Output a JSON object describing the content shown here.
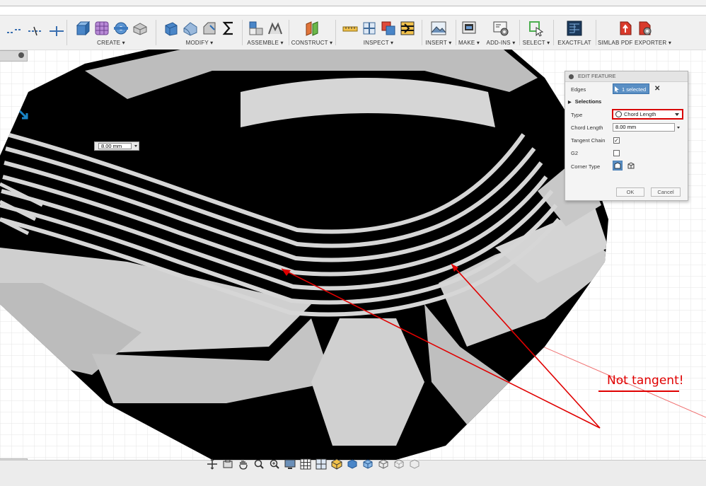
{
  "toolbar": {
    "groups": [
      {
        "label": "CREATE ▾"
      },
      {
        "label": "MODIFY ▾"
      },
      {
        "label": "ASSEMBLE ▾"
      },
      {
        "label": "CONSTRUCT ▾"
      },
      {
        "label": "INSPECT ▾"
      },
      {
        "label": "INSERT ▾"
      },
      {
        "label": "MAKE ▾"
      },
      {
        "label": "ADD-INS ▾"
      },
      {
        "label": "SELECT ▾"
      },
      {
        "label": "EXACTFLAT"
      },
      {
        "label": "SIMLAB PDF EXPORTER ▾"
      }
    ]
  },
  "edit_feature": {
    "title": "EDIT FEATURE",
    "edges_label": "Edges",
    "edges_value": "1 selected",
    "selections_label": "Selections",
    "type_label": "Type",
    "type_value": "Chord Length",
    "chord_length_label": "Chord Length",
    "chord_length_value": "8.00 mm",
    "tangent_chain_label": "Tangent Chain",
    "tangent_chain_checked": true,
    "g2_label": "G2",
    "g2_checked": false,
    "corner_type_label": "Corner Type",
    "ok_label": "OK",
    "cancel_label": "Cancel"
  },
  "viewport": {
    "dimension_input_value": "8.00 mm",
    "annotation_text": "Not tangent!",
    "annotation_color": "#e00000"
  },
  "colors": {
    "accent": "#5a8fc4",
    "highlight_border": "#d90000",
    "model_black": "#000000",
    "model_grey": "#c8c8c8"
  }
}
